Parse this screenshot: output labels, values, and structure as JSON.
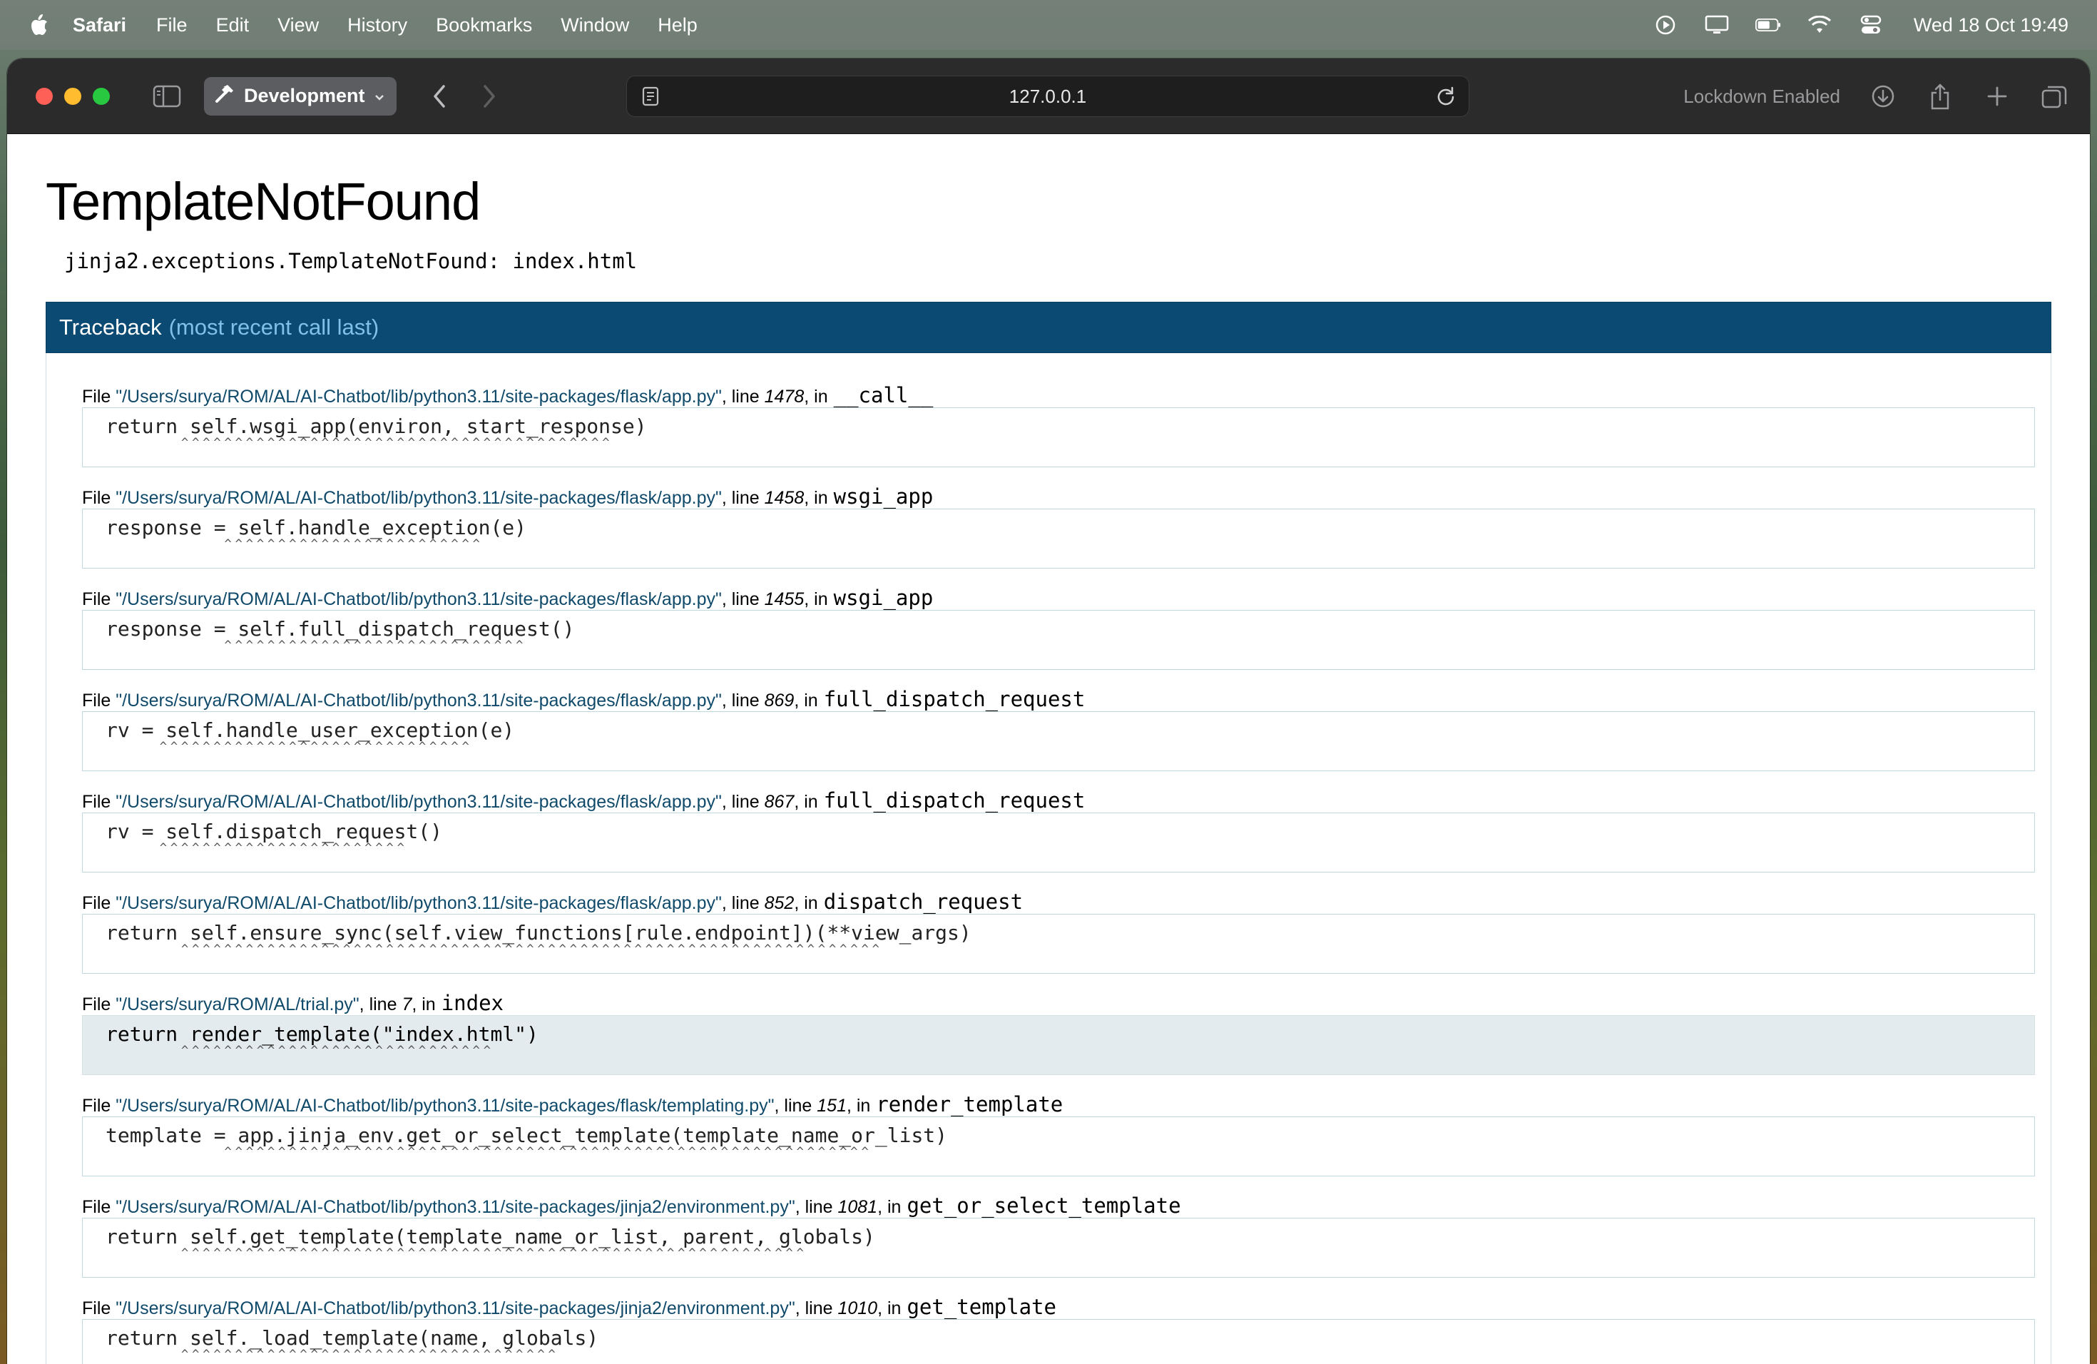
{
  "menubar": {
    "app_name": "Safari",
    "menus": [
      "File",
      "Edit",
      "View",
      "History",
      "Bookmarks",
      "Window",
      "Help"
    ],
    "clock": "Wed 18 Oct  19:49"
  },
  "toolbar": {
    "tab_group_label": "Development",
    "url": "127.0.0.1",
    "lockdown_label": "Lockdown Enabled"
  },
  "error": {
    "title": "TemplateNotFound",
    "message": "jinja2.exceptions.TemplateNotFound: index.html"
  },
  "traceback": {
    "label": "Traceback",
    "sub_label": "(most recent call last)",
    "frames": [
      {
        "path": "\"/Users/surya/ROM/AL/AI-Chatbot/lib/python3.11/site-packages/flask/app.py\"",
        "line": "1478",
        "func": "__call__",
        "code": "return self.wsgi_app(environ, start_response)",
        "squig_prefix": "       ",
        "squiggle": "^^^^^^^^^^^^^^^^^^^^^^^^^^^^^^^^^^^^^^^^",
        "current": false
      },
      {
        "path": "\"/Users/surya/ROM/AL/AI-Chatbot/lib/python3.11/site-packages/flask/app.py\"",
        "line": "1458",
        "func": "wsgi_app",
        "code": "response = self.handle_exception(e)",
        "squig_prefix": "           ",
        "squiggle": "^^^^^^^^^^^^^^^^^^^^^^^^",
        "current": false
      },
      {
        "path": "\"/Users/surya/ROM/AL/AI-Chatbot/lib/python3.11/site-packages/flask/app.py\"",
        "line": "1455",
        "func": "wsgi_app",
        "code": "response = self.full_dispatch_request()",
        "squig_prefix": "           ",
        "squiggle": "^^^^^^^^^^^^^^^^^^^^^^^^^^^^",
        "current": false
      },
      {
        "path": "\"/Users/surya/ROM/AL/AI-Chatbot/lib/python3.11/site-packages/flask/app.py\"",
        "line": "869",
        "func": "full_dispatch_request",
        "code": "rv = self.handle_user_exception(e)",
        "squig_prefix": "     ",
        "squiggle": "^^^^^^^^^^^^^^^^^^^^^^^^^^^^^",
        "current": false
      },
      {
        "path": "\"/Users/surya/ROM/AL/AI-Chatbot/lib/python3.11/site-packages/flask/app.py\"",
        "line": "867",
        "func": "full_dispatch_request",
        "code": "rv = self.dispatch_request()",
        "squig_prefix": "     ",
        "squiggle": "^^^^^^^^^^^^^^^^^^^^^^^",
        "current": false
      },
      {
        "path": "\"/Users/surya/ROM/AL/AI-Chatbot/lib/python3.11/site-packages/flask/app.py\"",
        "line": "852",
        "func": "dispatch_request",
        "code": "return self.ensure_sync(self.view_functions[rule.endpoint])(**view_args)",
        "squig_prefix": "       ",
        "squiggle": "^^^^^^^^^^^^^^^^^^^^^^^^^^^^^^^^^^^^^^^^^^^^^^^^^^^^^^^^^^^^^^^^^",
        "current": false
      },
      {
        "path": "\"/Users/surya/ROM/AL/trial.py\"",
        "line": "7",
        "func": "index",
        "code": "return render_template(\"index.html\")",
        "squig_prefix": "       ",
        "squiggle": "^^^^^^^^^^^^^^^^^^^^^^^^^^^^^",
        "current": true
      },
      {
        "path": "\"/Users/surya/ROM/AL/AI-Chatbot/lib/python3.11/site-packages/flask/templating.py\"",
        "line": "151",
        "func": "render_template",
        "code": "template = app.jinja_env.get_or_select_template(template_name_or_list)",
        "squig_prefix": "           ",
        "squiggle": "^^^^^^^^^^^^^^^^^^^^^^^^^^^^^^^^^^^^^^^^^^^^^^^^^^^^^^^^^^^^",
        "current": false
      },
      {
        "path": "\"/Users/surya/ROM/AL/AI-Chatbot/lib/python3.11/site-packages/jinja2/environment.py\"",
        "line": "1081",
        "func": "get_or_select_template",
        "code": "return self.get_template(template_name_or_list, parent, globals)",
        "squig_prefix": "       ",
        "squiggle": "^^^^^^^^^^^^^^^^^^^^^^^^^^^^^^^^^^^^^^^^^^^^^^^^^^^^^^^^^^",
        "current": false
      },
      {
        "path": "\"/Users/surya/ROM/AL/AI-Chatbot/lib/python3.11/site-packages/jinja2/environment.py\"",
        "line": "1010",
        "func": "get_template",
        "code": "return self._load_template(name, globals)",
        "squig_prefix": "       ",
        "squiggle": "^^^^^^^^^^^^^^^^^^^^^^^^^^^^^^^^^^^",
        "current": false
      }
    ]
  },
  "colors": {
    "traceback_header_bg": "#0b4a72",
    "traceback_sub_label": "#7fc1e8",
    "file_path": "#104a6b",
    "current_frame_bg": "#e4ebee"
  },
  "icons": [
    "apple-icon",
    "play-icon",
    "display-icon",
    "battery-icon",
    "wifi-icon",
    "control-center-icon",
    "sidebar-icon",
    "hammer-icon",
    "chevron-down-icon",
    "back-icon",
    "forward-icon",
    "page-icon",
    "reload-icon",
    "download-icon",
    "share-icon",
    "new-tab-icon",
    "tab-overview-icon"
  ]
}
